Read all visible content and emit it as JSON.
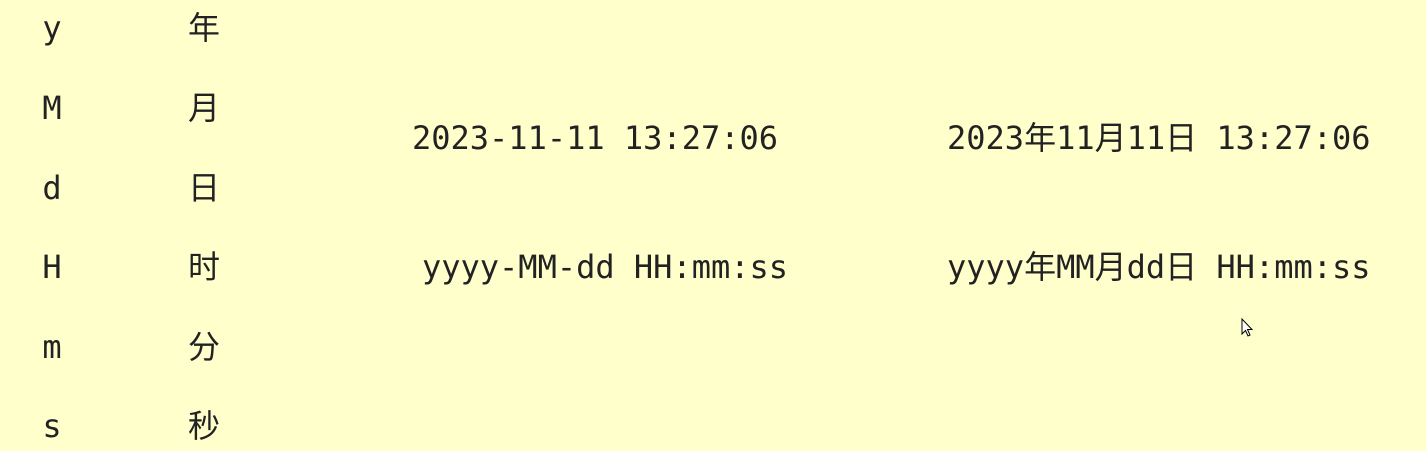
{
  "legend": [
    {
      "symbol": "y",
      "meaning": "年"
    },
    {
      "symbol": "M",
      "meaning": "月"
    },
    {
      "symbol": "d",
      "meaning": "日"
    },
    {
      "symbol": "H",
      "meaning": "时"
    },
    {
      "symbol": "m",
      "meaning": "分"
    },
    {
      "symbol": "s",
      "meaning": "秒"
    }
  ],
  "examples": {
    "dash_value": "2023-11-11 13:27:06",
    "dash_pattern": "yyyy-MM-dd HH:mm:ss",
    "cn_value": "2023年11月11日 13:27:06",
    "cn_pattern": "yyyy年MM月dd日 HH:mm:ss"
  },
  "cursor_icon": "mouse-pointer-icon"
}
